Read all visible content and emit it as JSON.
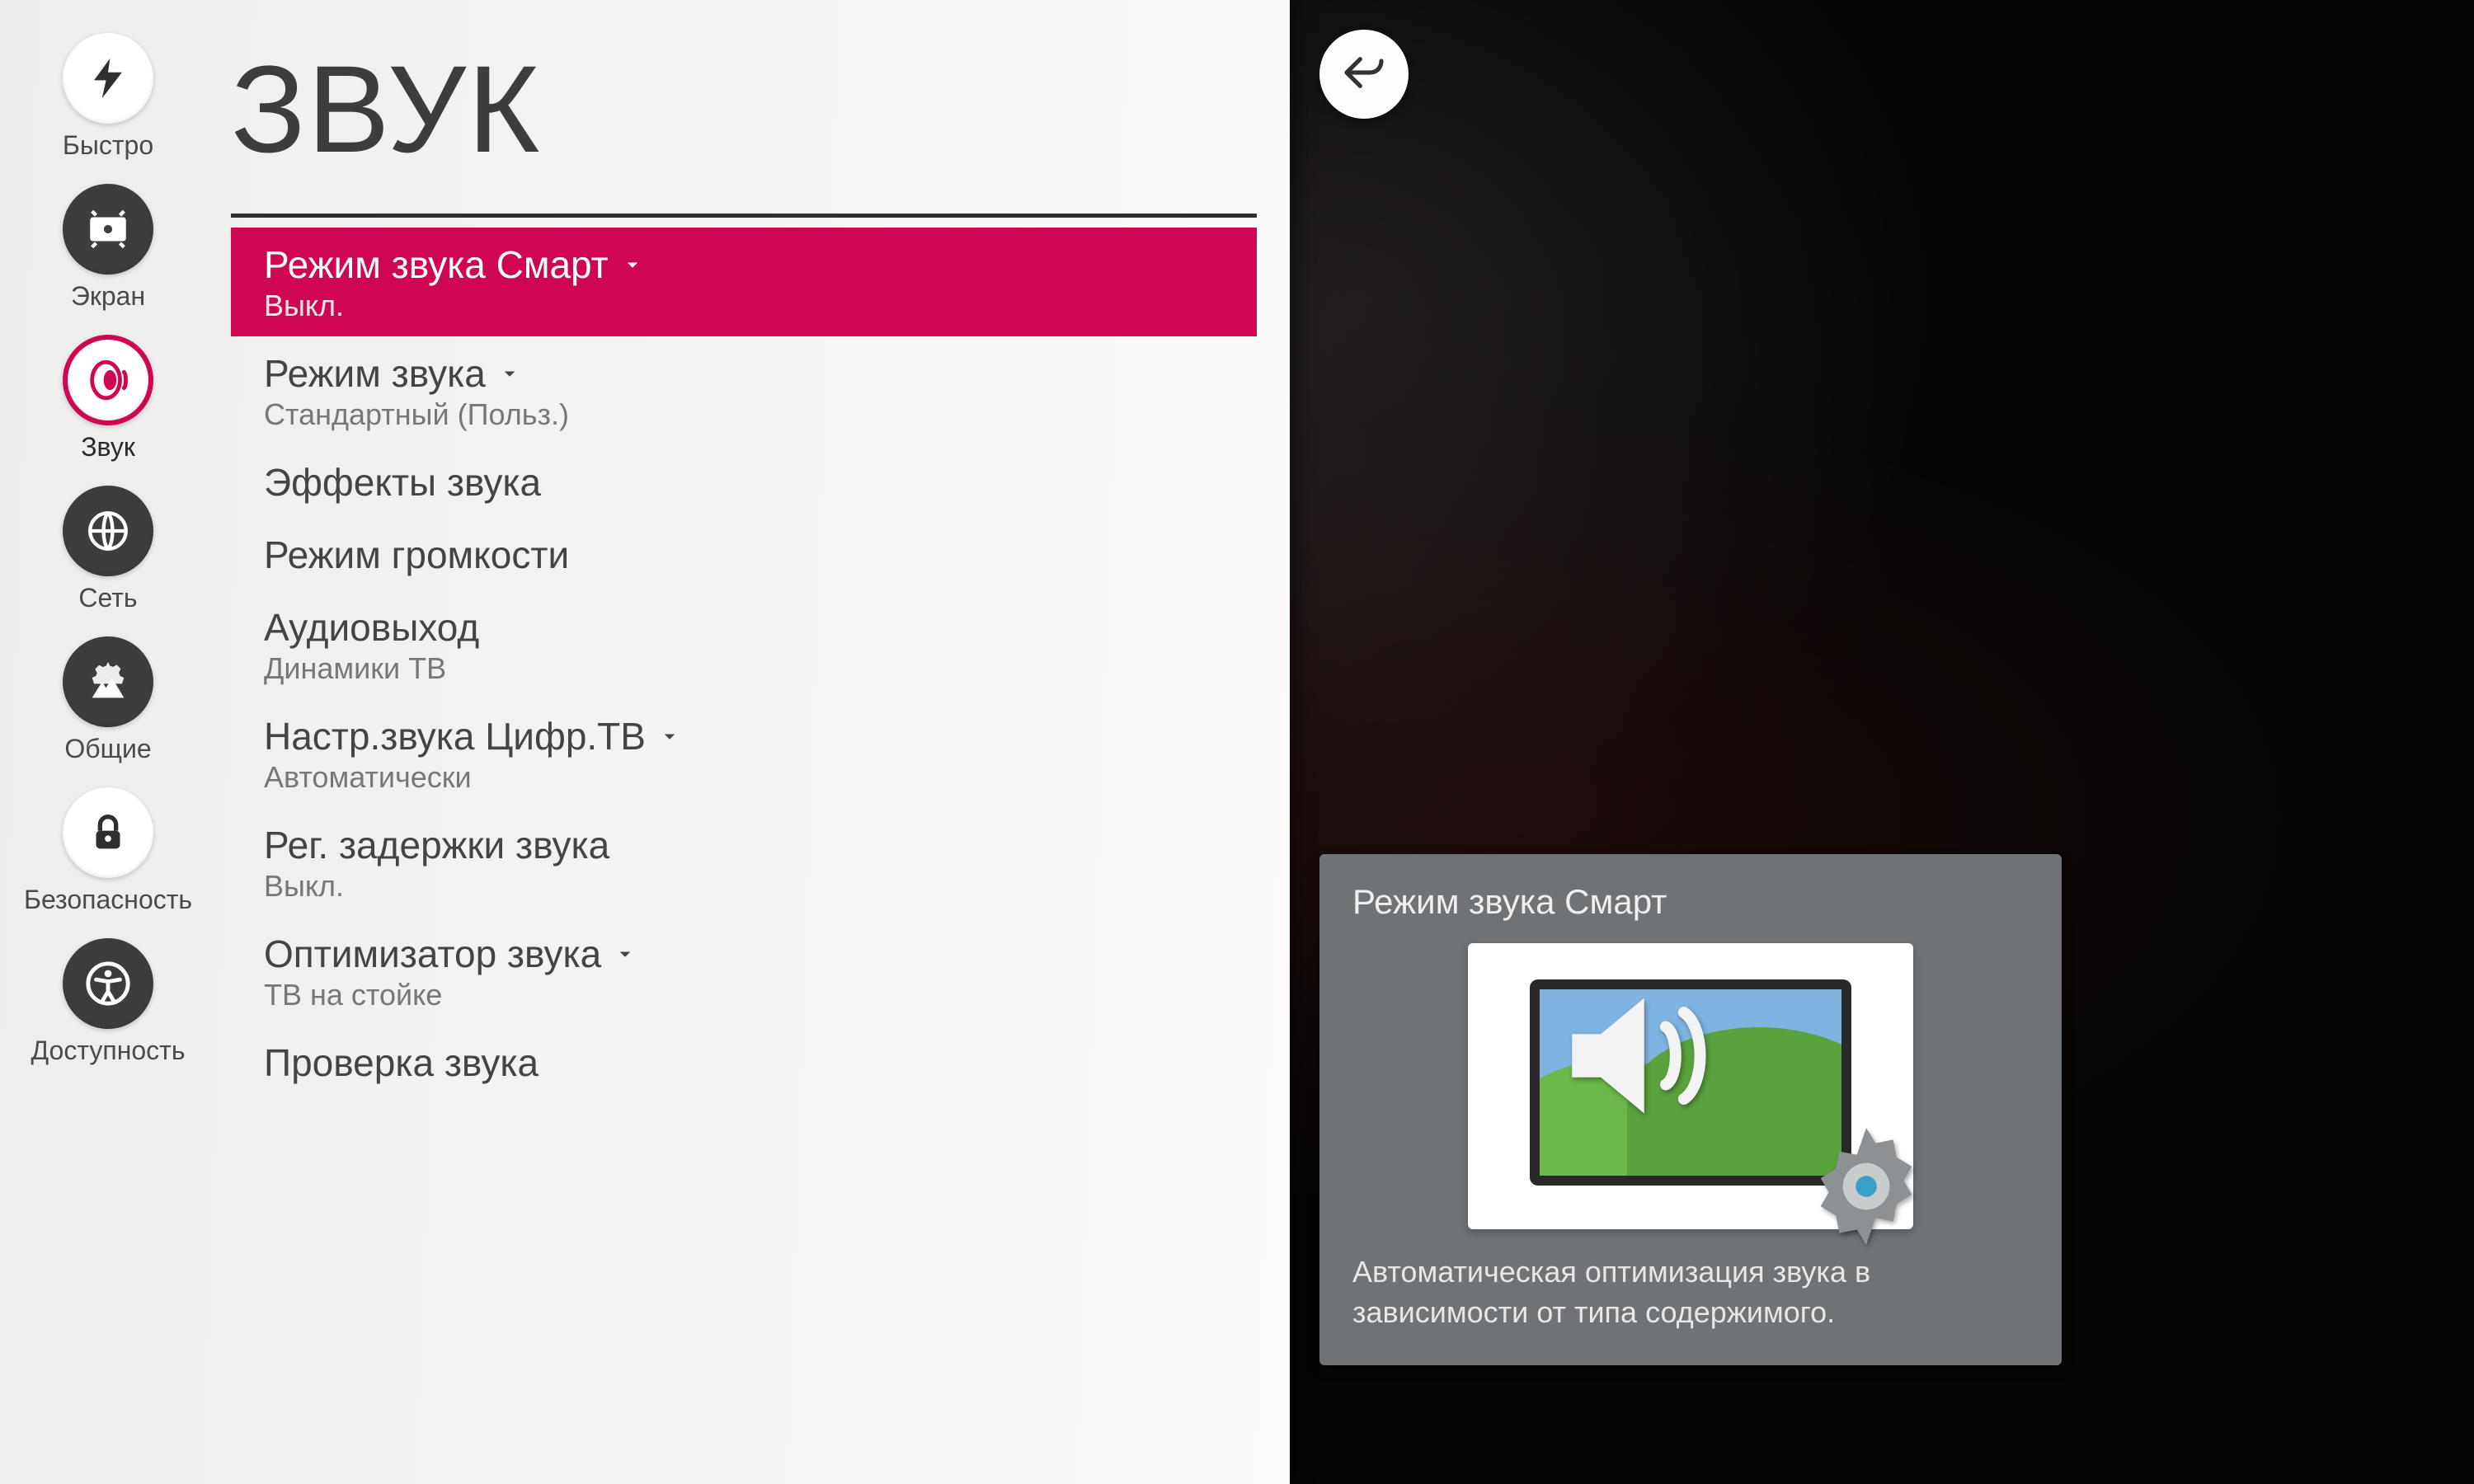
{
  "colors": {
    "accent": "#cf0652"
  },
  "back_button": {
    "label": "Назад"
  },
  "sidebar": {
    "items": [
      {
        "icon": "bolt",
        "label": "Быстро"
      },
      {
        "icon": "screen",
        "label": "Экран"
      },
      {
        "icon": "sound",
        "label": "Звук",
        "active": true
      },
      {
        "icon": "network",
        "label": "Сеть"
      },
      {
        "icon": "general",
        "label": "Общие"
      },
      {
        "icon": "security",
        "label": "Безопасность"
      },
      {
        "icon": "accessibility",
        "label": "Доступность"
      }
    ]
  },
  "page": {
    "title": "ЗВУК"
  },
  "menu": [
    {
      "title": "Режим звука Смарт",
      "sub": "Выкл.",
      "expandable": true,
      "selected": true
    },
    {
      "title": "Режим звука",
      "sub": "Стандартный (Польз.)",
      "expandable": true
    },
    {
      "title": "Эффекты звука",
      "sub": ""
    },
    {
      "title": "Режим громкости",
      "sub": ""
    },
    {
      "title": "Аудиовыход",
      "sub": "Динамики ТВ"
    },
    {
      "title": "Настр.звука Цифр.ТВ",
      "sub": "Автоматически",
      "expandable": true
    },
    {
      "title": "Рег. задержки звука",
      "sub": "Выкл."
    },
    {
      "title": "Оптимизатор звука",
      "sub": "ТВ на стойке",
      "expandable": true
    },
    {
      "title": "Проверка звука",
      "sub": ""
    }
  ],
  "help": {
    "title": "Режим звука Смарт",
    "description": "Автоматическая оптимизация звука в зависимости от типа содержимого."
  }
}
